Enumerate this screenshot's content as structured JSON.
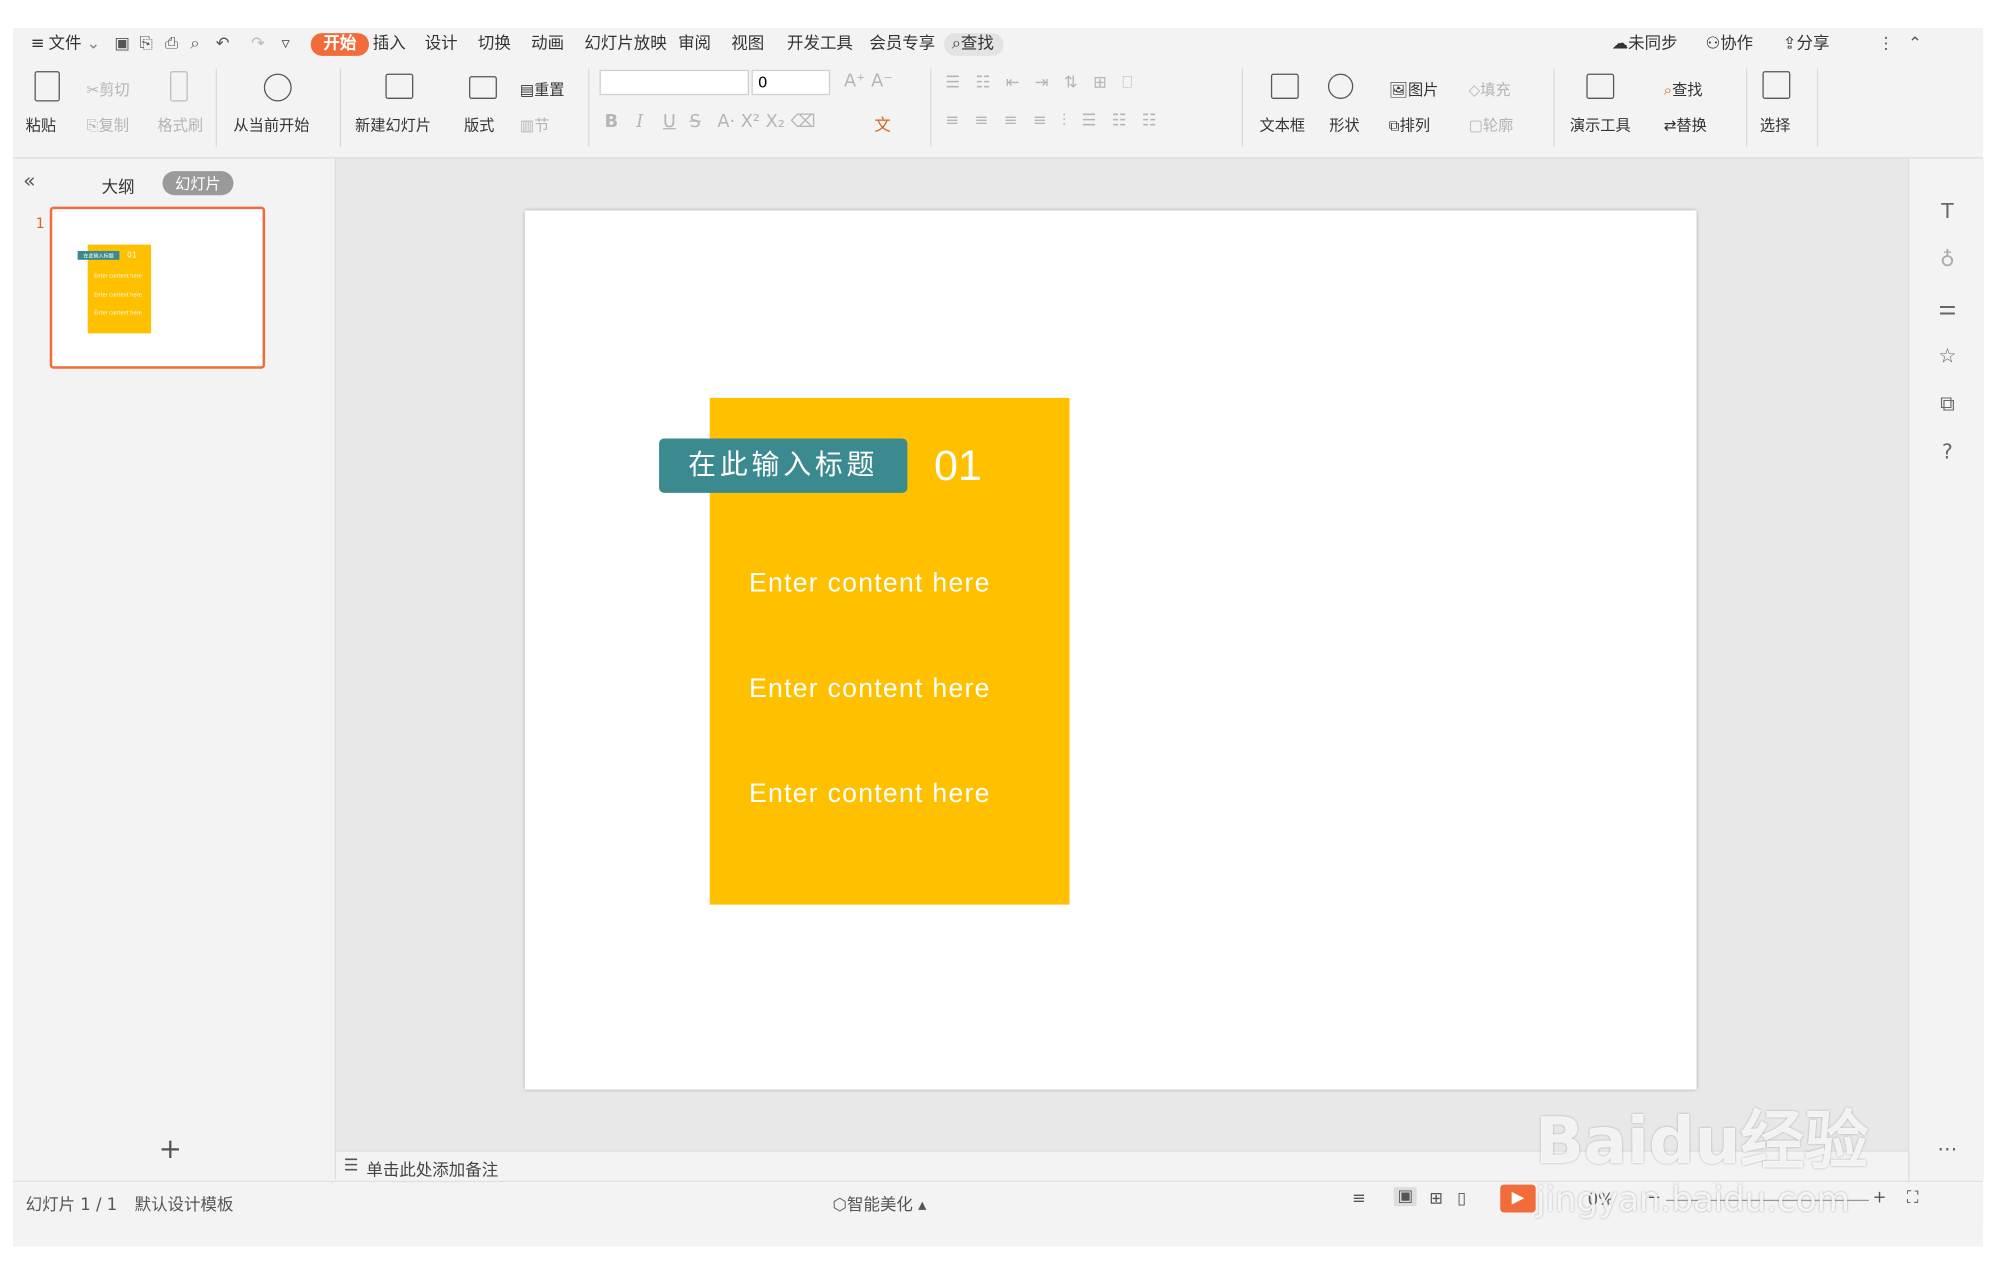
{
  "menu": {
    "file_label": "文件",
    "tabs": [
      "开始",
      "插入",
      "设计",
      "切换",
      "动画",
      "幻灯片放映",
      "审阅",
      "视图",
      "开发工具",
      "会员专享"
    ],
    "search_label": "查找",
    "right": {
      "sync": "未同步",
      "collab": "协作",
      "share": "分享"
    }
  },
  "ribbon": {
    "paste": "粘贴",
    "cut": "剪切",
    "copy": "复制",
    "format_painter": "格式刷",
    "from_current": "从当前开始",
    "new_slide": "新建幻灯片",
    "layout": "版式",
    "reset": "重置",
    "section": "节",
    "font_size_value": "0",
    "textbox": "文本框",
    "shape": "形状",
    "picture": "图片",
    "fill": "填充",
    "arrange": "排列",
    "outline": "轮廓",
    "present_tools": "演示工具",
    "find": "查找",
    "replace": "替换",
    "select": "选择",
    "format_glyphs": {
      "bold": "B",
      "italic": "I",
      "underline": "U",
      "strike": "S"
    }
  },
  "left_panel": {
    "tab_outline": "大纲",
    "tab_slides": "幻灯片",
    "slide_number": "1",
    "add_glyph": "+"
  },
  "slide": {
    "title": "在此输入标题",
    "number": "01",
    "items": [
      "Enter content here",
      "Enter content here",
      "Enter content here"
    ]
  },
  "thumbnail": {
    "title": "在此输入标题",
    "number": "01",
    "items": [
      "Enter content here",
      "Enter content here",
      "Enter content here"
    ]
  },
  "notes_placeholder": "单击此处添加备注",
  "status": {
    "slide_counter": "幻灯片 1 / 1",
    "template": "默认设计模板",
    "beautify": "智能美化",
    "zoom": "0%"
  },
  "colors": {
    "accent": "#f26b3a",
    "card": "#ffc000",
    "title_box": "#3a8a8f",
    "thumb_border": "#f26b3a"
  },
  "watermark": {
    "brand": "Baidu经验",
    "url": "jingyan.baidu.com"
  }
}
